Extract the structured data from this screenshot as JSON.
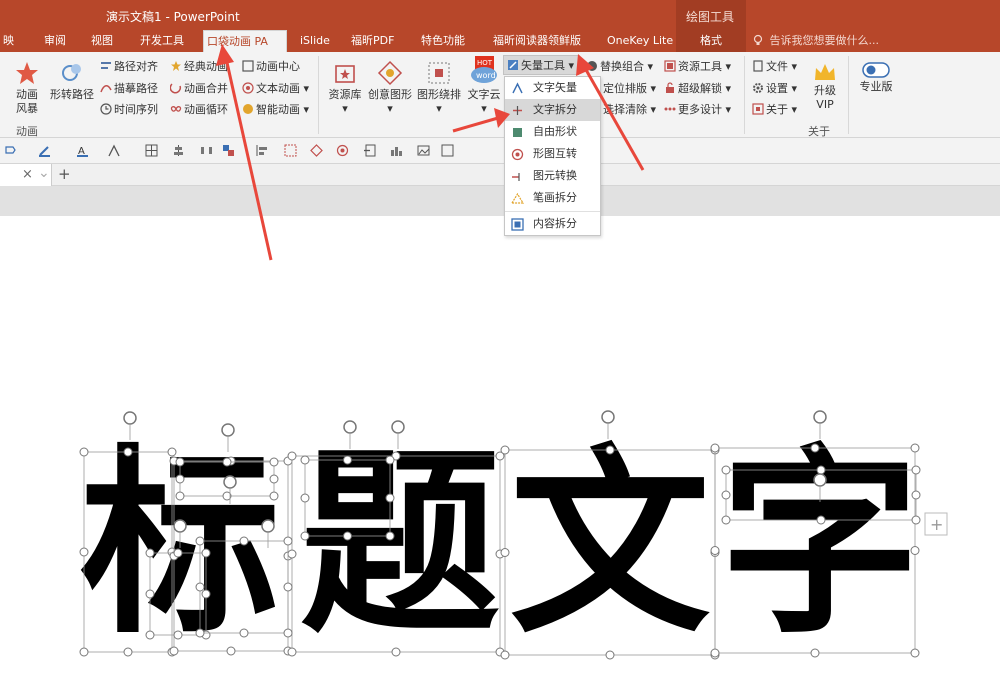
{
  "title_bar": {
    "document_title": "演示文稿1 - PowerPoint",
    "context_group": "绘图工具"
  },
  "tabs": [
    "映",
    "审阅",
    "视图",
    "开发工具",
    "口袋动画 PA",
    "iSlide",
    "福昕PDF",
    "特色功能",
    "福昕阅读器领鲜版",
    "OneKey Lite",
    "格式"
  ],
  "tell_me": "告诉我您想要做什么...",
  "ribbon": {
    "anim_group": {
      "big1": [
        "动画",
        "风暴"
      ],
      "big2": "形转路径",
      "col1": [
        "路径对齐",
        "描摹路径",
        "时间序列"
      ],
      "col2": [
        "经典动画",
        "动画合并",
        "动画循环"
      ],
      "col3": [
        "动画中心",
        "文本动画",
        "智能动画"
      ],
      "label": "动画"
    },
    "design_group": {
      "big": [
        "资源库",
        "创意图形",
        "图形绕排",
        "文字云"
      ],
      "hot_badge": "HOT",
      "word_badge": "word",
      "vector_tools": "矢量工具",
      "col_a": [
        "替换组合",
        "定位排版",
        "选择清除"
      ],
      "col_b": [
        "资源工具",
        "超级解锁",
        "更多设计"
      ]
    },
    "about_group": {
      "col": [
        "文件",
        "设置",
        "关于"
      ],
      "upgrade": [
        "升级",
        "VIP"
      ],
      "pro": "专业版",
      "label": "关于"
    }
  },
  "vector_menu": {
    "items": [
      "文字矢量",
      "文字拆分",
      "自由形状",
      "形图互转",
      "图元转换",
      "笔画拆分",
      "内容拆分"
    ],
    "highlighted": "文字拆分"
  },
  "slide": {
    "characters": [
      "标",
      "题",
      "文",
      "字"
    ]
  },
  "colors": {
    "accent": "#b7472a",
    "arrow": "#e8473b"
  }
}
